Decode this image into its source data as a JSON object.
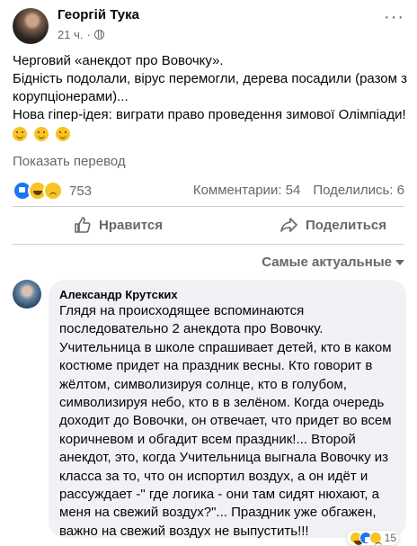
{
  "post": {
    "author": "Георгій Тука",
    "time": "21 ч.",
    "more_icon": "more-horizontal-icon",
    "lines": [
      "Черговий «анекдот про Вовочку».",
      "Бідність подолали, вірус перемогли, дерева посадили (разом з",
      "корупціонерами)...",
      "Нова гіпер-ідея: виграти право проведення зимової Олімпіади!"
    ],
    "emojis": [
      "smiling-face-icon",
      "smiling-face-icon",
      "smiling-face-icon"
    ],
    "translate_label": "Показать перевод",
    "reactions": [
      "like-icon",
      "haha-icon",
      "sad-icon"
    ],
    "reaction_count": "753",
    "comments_label": "Комментарии: 54",
    "shares_label": "Поделились: 6"
  },
  "actions": {
    "like_label": "Нравится",
    "share_label": "Поделиться"
  },
  "sort_label": "Самые актуальные",
  "comment": {
    "author": "Александр Крутских",
    "lines": [
      "Глядя на происходящее вспоминаются",
      "последовательно 2 анекдота про Вовочку.",
      "Учительница в школе спрашивает детей, кто в каком",
      "костюме придет на праздник весны. Кто говорит в",
      "жёлтом, символизируя солнце, кто в голубом,",
      "символизируя небо, кто в в зелёном. Когда очередь",
      "доходит до Вовочки, он отвечает, что придет во всем",
      "коричневом и обгадит всем праздник!... Второй",
      "анекдот, это, когда Учительница выгнала Вовочку из",
      "класса за то, что он испортил воздух, а он идёт и",
      "рассуждает -\" где логика - они там сидят нюхают, а",
      "меня на свежий воздух?\"... Праздник уже обгажен,",
      "важно на свежий воздух не выпустить!!!"
    ],
    "reaction_count": "15"
  }
}
